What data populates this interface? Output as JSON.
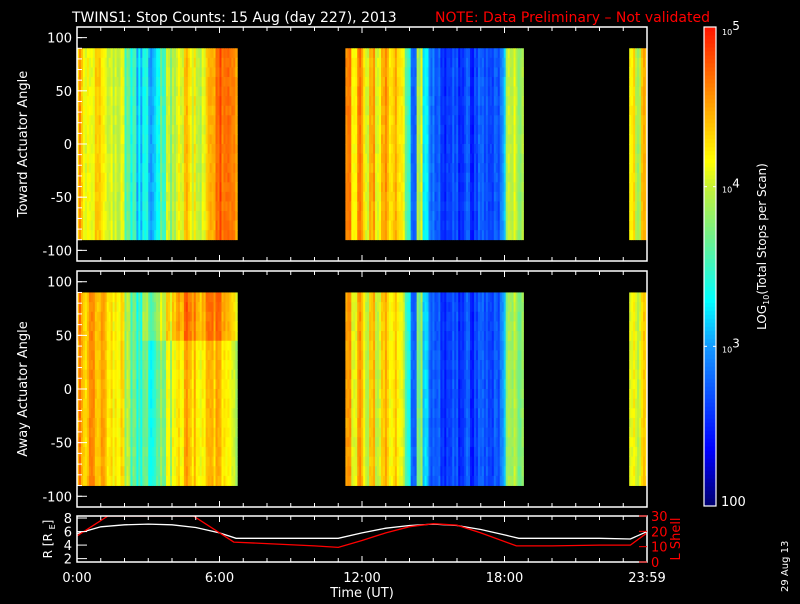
{
  "title": "TWINS1: Stop Counts: 15 Aug (day 227), 2013",
  "note": "NOTE: Data Preliminary – Not validated",
  "date_stamp": "29 Aug 13",
  "colors": {
    "background": "#000000",
    "axis": "#ffffff",
    "note": "#ff0000",
    "lshell": "#ff0000",
    "radius": "#ffffff"
  },
  "chart_data": [
    {
      "type": "heatmap",
      "name": "toward",
      "ylabel": "Toward Actuator Angle",
      "ylim": [
        -110,
        110
      ],
      "yticks": [
        "100",
        "50",
        "0",
        "-50",
        "-100"
      ],
      "ytick_values": [
        100,
        50,
        0,
        -50,
        -100
      ],
      "angle_range": [
        -90,
        90
      ],
      "xlim_hours": [
        0,
        24
      ],
      "segments": [
        {
          "start_h": 0.0,
          "bin_h": 0.25,
          "log_counts": [
            4.5,
            4.2,
            4.0,
            4.3,
            4.1,
            4.0,
            3.9,
            4.0,
            3.6,
            3.4,
            3.2,
            3.3,
            3.1,
            3.2,
            3.6,
            3.9,
            4.0,
            4.2,
            4.3,
            4.1,
            3.9,
            4.2,
            4.5,
            4.6,
            4.7,
            4.7,
            4.6
          ]
        },
        {
          "start_h": 11.3,
          "bin_h": 0.25,
          "log_counts": [
            4.5,
            4.3,
            4.6,
            4.2,
            4.4,
            4.1,
            4.5,
            4.3,
            4.4,
            4.2,
            3.6,
            2.9,
            4.0,
            3.2,
            2.9,
            2.7,
            2.6,
            2.6,
            2.7,
            2.6,
            2.7,
            2.6,
            2.7,
            2.8,
            2.7,
            2.8,
            3.0,
            3.9,
            4.0,
            3.8
          ]
        },
        {
          "start_h": 23.25,
          "bin_h": 0.25,
          "log_counts": [
            4.2,
            3.8,
            4.4
          ]
        }
      ]
    },
    {
      "type": "heatmap",
      "name": "away",
      "ylabel": "Away Actuator Angle",
      "ylim": [
        -110,
        110
      ],
      "yticks": [
        "100",
        "50",
        "0",
        "-50",
        "-100"
      ],
      "ytick_values": [
        100,
        50,
        0,
        -50,
        -100
      ],
      "angle_range": [
        -90,
        90
      ],
      "xlim_hours": [
        0,
        24
      ],
      "segments": [
        {
          "start_h": 0.0,
          "bin_h": 0.25,
          "log_counts": [
            4.6,
            4.4,
            4.5,
            4.3,
            4.4,
            4.2,
            4.1,
            4.2,
            3.9,
            3.6,
            3.5,
            3.6,
            3.4,
            3.5,
            3.8,
            4.0,
            4.2,
            4.3,
            4.4,
            4.3,
            4.1,
            4.3,
            4.5,
            4.4,
            4.3,
            4.2,
            4.0
          ]
        },
        {
          "start_h": 11.3,
          "bin_h": 0.25,
          "log_counts": [
            4.4,
            4.2,
            4.5,
            4.1,
            4.3,
            4.0,
            4.4,
            4.2,
            4.3,
            4.1,
            3.5,
            2.9,
            3.8,
            3.1,
            2.8,
            2.7,
            2.6,
            2.6,
            2.7,
            2.6,
            2.7,
            2.6,
            2.7,
            2.8,
            2.7,
            2.8,
            3.0,
            3.8,
            3.9,
            3.7
          ]
        },
        {
          "start_h": 23.25,
          "bin_h": 0.25,
          "log_counts": [
            4.1,
            3.9,
            4.3
          ]
        }
      ]
    },
    {
      "type": "line",
      "name": "orbit",
      "xlabel": "Time (UT)",
      "xticks": [
        "0:00",
        "6:00",
        "12:00",
        "18:00",
        "23:59"
      ],
      "xtick_values": [
        0,
        6,
        12,
        18,
        24
      ],
      "ylabel_left": "R [R",
      "ylabel_left_sub": "E",
      "ylabel_left_end": "]",
      "ylim_left": [
        1.5,
        8.3
      ],
      "yticks_left": [
        "8",
        "6",
        "4",
        "2"
      ],
      "ytick_left_values": [
        8,
        6,
        4,
        2
      ],
      "ylabel_right": "L Shell",
      "ylim_right": [
        0,
        30
      ],
      "yticks_right": [
        "30",
        "20",
        "10",
        "0"
      ],
      "ytick_right_values": [
        30,
        20,
        10,
        0
      ],
      "series": [
        {
          "name": "R",
          "axis": "left",
          "x": [
            0,
            1,
            2,
            3,
            4,
            5,
            6,
            6.7,
            8,
            10,
            11,
            12,
            13,
            14,
            15,
            16,
            17,
            18,
            18.6,
            20,
            22,
            23.3,
            24
          ],
          "y": [
            5.7,
            6.7,
            7.0,
            7.1,
            7.0,
            6.6,
            5.8,
            5.0,
            5.0,
            5.0,
            5.0,
            5.8,
            6.5,
            6.9,
            7.1,
            6.9,
            6.3,
            5.5,
            5.0,
            5.0,
            5.0,
            4.9,
            6.0
          ]
        },
        {
          "name": "L Shell",
          "axis": "right",
          "x": [
            0,
            1.3,
            4.9,
            6.6,
            8,
            10,
            11,
            12,
            13,
            14,
            15,
            16,
            17,
            18.5,
            20,
            22,
            23.3,
            24
          ],
          "y": [
            17,
            30,
            30,
            13,
            12,
            10.5,
            9.5,
            14,
            19,
            23,
            25,
            24,
            19,
            10.5,
            10.5,
            11,
            11,
            19
          ]
        }
      ]
    }
  ],
  "colorbar": {
    "label_main": "LOG",
    "label_sub": "10",
    "label_rest": "(Total Stops per Scan)",
    "ticks": [
      {
        "base": "10",
        "exp": "5",
        "value": 5
      },
      {
        "base": "10",
        "exp": "4",
        "value": 4
      },
      {
        "base": "10",
        "exp": "3",
        "value": 3
      },
      {
        "base": "100",
        "exp": "",
        "value": 2
      }
    ],
    "range_log": [
      2,
      5
    ]
  }
}
